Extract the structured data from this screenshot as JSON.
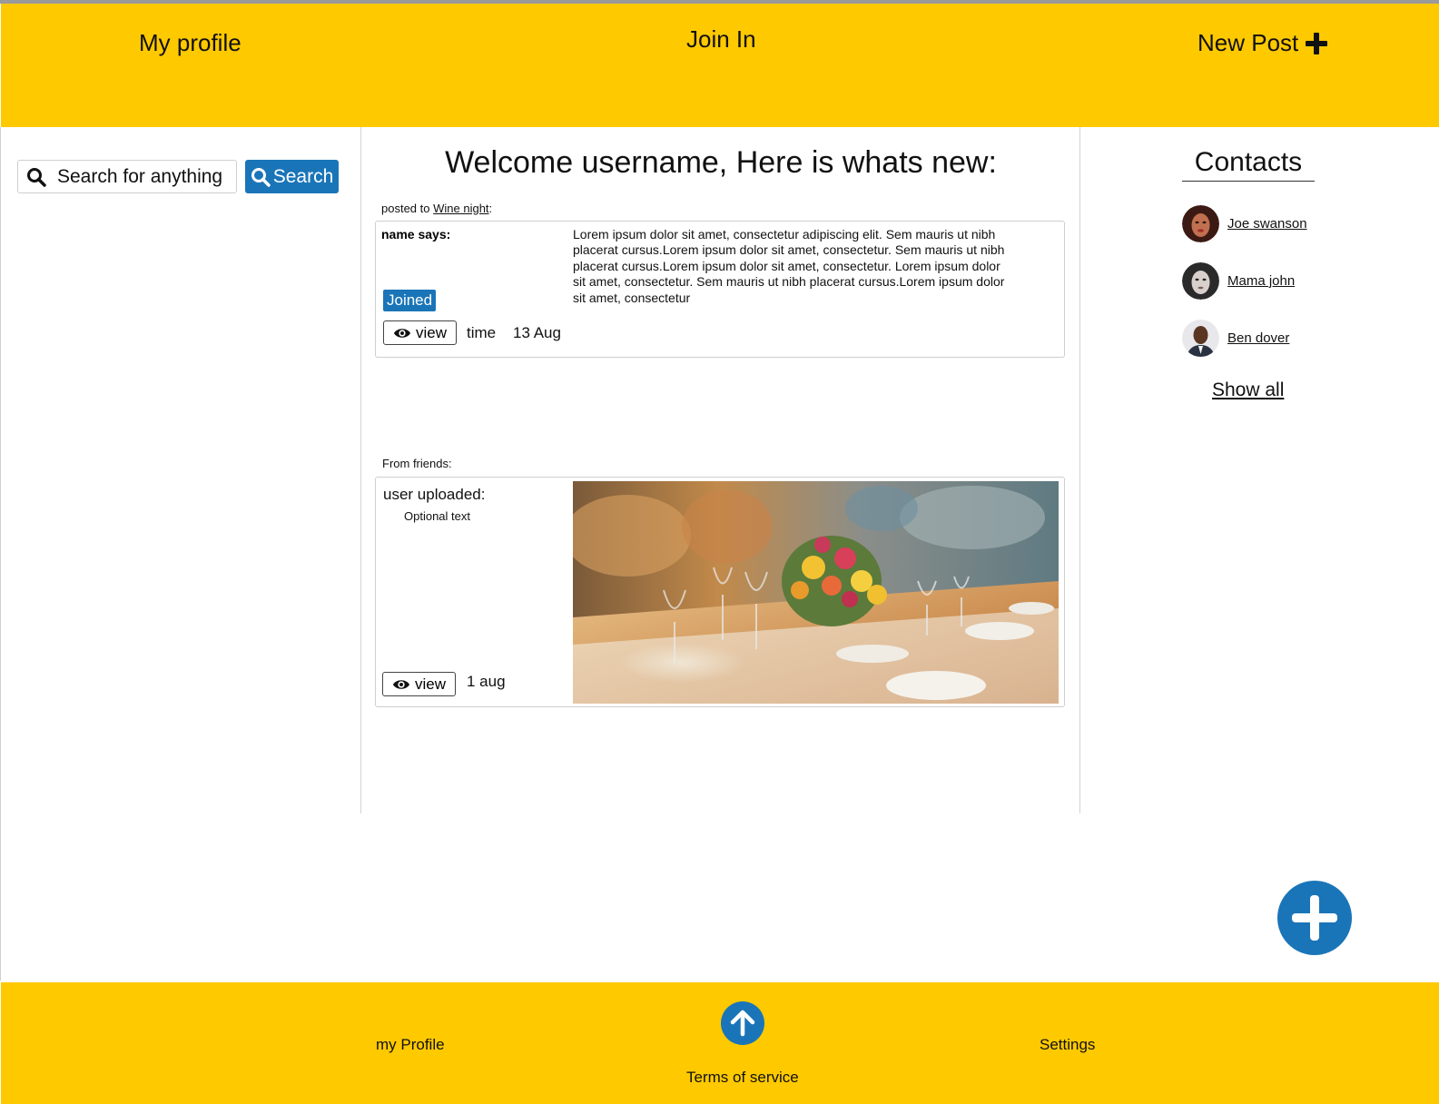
{
  "header": {
    "my_profile": "My profile",
    "join_in": "Join In",
    "new_post": "New Post"
  },
  "search": {
    "placeholder": "Search for anything",
    "button_label": "Search"
  },
  "feed": {
    "welcome": "Welcome username, Here is whats new:",
    "posted_to_prefix": "posted to",
    "posted_to_group": "Wine night",
    "posted_to_suffix": ":",
    "post": {
      "author_says": "name says:",
      "badge": "Joined",
      "body": "Lorem ipsum dolor sit amet, consectetur adipiscing elit. Sem mauris ut nibh placerat cursus.Lorem ipsum dolor sit amet, consectetur. Sem mauris ut nibh placerat cursus.Lorem ipsum dolor sit amet, consectetur. Lorem ipsum dolor sit amet, consectetur. Sem mauris ut nibh placerat cursus.Lorem ipsum dolor sit amet, consectetur",
      "view_label": "view",
      "time_label": "time",
      "date": "13 Aug"
    },
    "from_friends_label": "From friends:",
    "upload": {
      "title": "user uploaded:",
      "optional_text": "Optional text",
      "view_label": "view",
      "date": "1 aug"
    }
  },
  "contacts": {
    "title": "Contacts",
    "items": [
      {
        "name": "Joe swanson"
      },
      {
        "name": "Mama john"
      },
      {
        "name": "Ben dover"
      }
    ],
    "show_all": "Show all"
  },
  "footer": {
    "my_profile": "my Profile",
    "terms": "Terms of service",
    "settings": "Settings"
  },
  "colors": {
    "header_bg": "#ffc900",
    "accent_blue": "#1a75b8"
  }
}
